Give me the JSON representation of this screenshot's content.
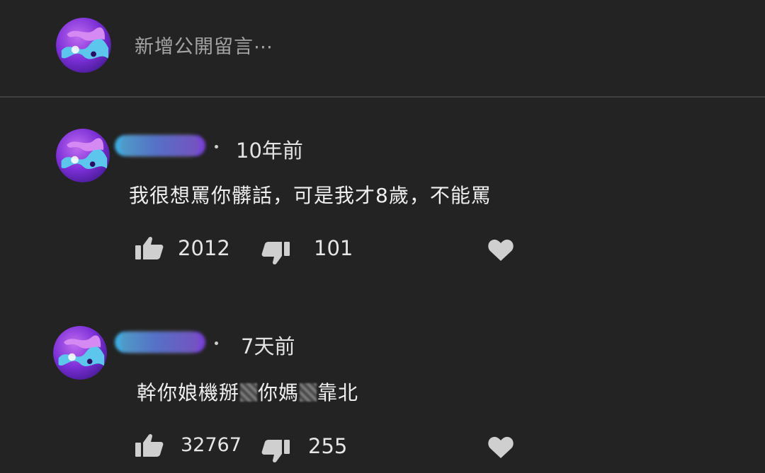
{
  "add_comment": {
    "placeholder": "新增公開留言⋯",
    "avatar_icon": "avatar-icon"
  },
  "comments": [
    {
      "time": "10年前",
      "text": "我很想罵你髒話，可是我才8歲，不能罵",
      "likes": "2012",
      "dislikes": "101"
    },
    {
      "time": "7天前",
      "text_parts": [
        "幹你娘機掰",
        "你媽",
        "靠北"
      ],
      "likes": "32767",
      "dislikes": "255"
    }
  ],
  "colors": {
    "background": "#232323",
    "divider": "#3f3f3f",
    "text": "#efefef",
    "muted": "#a4a4a4",
    "icon": "#cfcfcf",
    "avatar_purple": "#8a3fe6",
    "avatar_blue": "#4fb6e8"
  },
  "icons": [
    "thumbs-up-icon",
    "thumbs-down-icon",
    "heart-icon"
  ]
}
